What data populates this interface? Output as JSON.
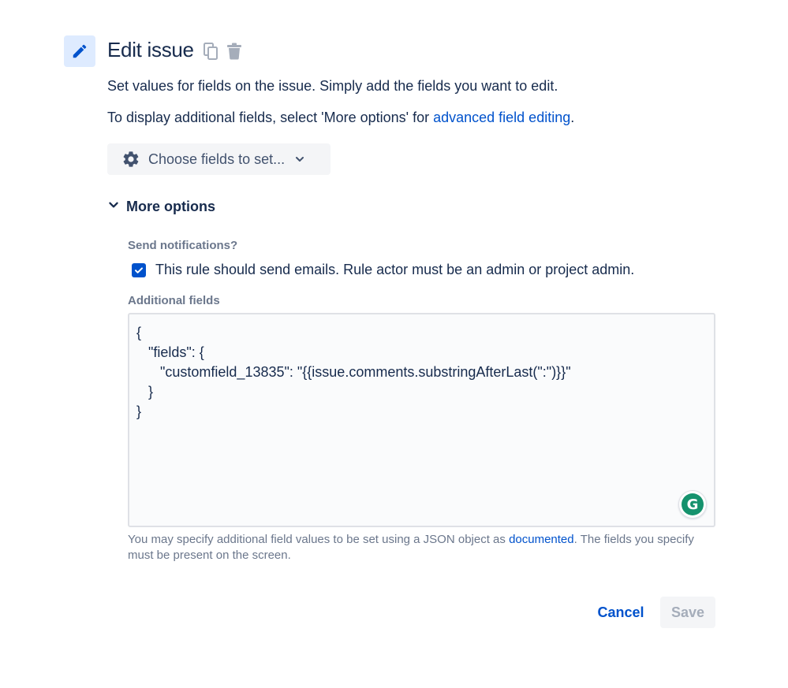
{
  "header": {
    "title": "Edit issue",
    "icons": [
      "pencil-icon",
      "copy-icon",
      "trash-icon"
    ]
  },
  "description": {
    "line1": "Set values for fields on the issue. Simply add the fields you want to edit.",
    "line2_prefix": "To display additional fields, select 'More options' for ",
    "line2_link": "advanced field editing",
    "line2_suffix": "."
  },
  "choose_fields": {
    "label": "Choose fields to set...",
    "icons": [
      "gear-icon",
      "chevron-down-icon"
    ]
  },
  "more_options": {
    "label": "More options",
    "expanded": true
  },
  "notifications": {
    "label": "Send notifications?",
    "checkbox_label": "This rule should send emails. Rule actor must be an admin or project admin.",
    "checked": true
  },
  "additional_fields": {
    "label": "Additional fields",
    "lines": [
      "{",
      "   \"fields\": {",
      "      \"customfield_13835\": \"{{issue.comments.substringAfterLast(\":\")}}\"",
      "   }",
      "}"
    ],
    "helper_prefix": "You may specify additional field values to be set using a JSON object as ",
    "helper_link": "documented",
    "helper_suffix": ". The fields you specify must be present on the screen."
  },
  "grammarly": {
    "letter": "G"
  },
  "actions": {
    "cancel_label": "Cancel",
    "save_label": "Save"
  },
  "colors": {
    "accent": "#0052cc",
    "icon_bg": "#deebff",
    "text": "#172b4d",
    "subtle_text": "#6b778c",
    "disabled_text": "#a5adba",
    "grammarly": "#15926d"
  }
}
